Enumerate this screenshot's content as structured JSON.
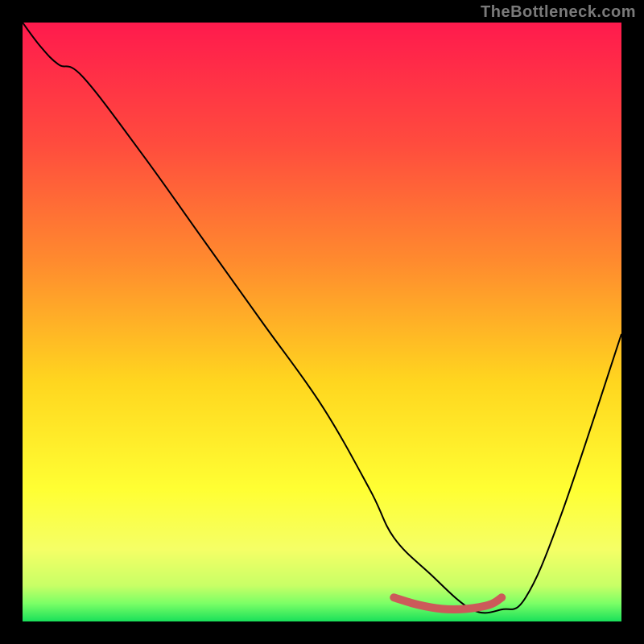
{
  "watermark": {
    "text": "TheBottleneck.com"
  },
  "chart_data": {
    "type": "line",
    "title": "",
    "xlabel": "",
    "ylabel": "",
    "xlim": [
      0,
      100
    ],
    "ylim": [
      0,
      100
    ],
    "gradient_stops": [
      {
        "pos": 0.0,
        "color": "#ff1a4d"
      },
      {
        "pos": 0.2,
        "color": "#ff4b3e"
      },
      {
        "pos": 0.4,
        "color": "#ff8b2e"
      },
      {
        "pos": 0.6,
        "color": "#ffd61f"
      },
      {
        "pos": 0.78,
        "color": "#ffff33"
      },
      {
        "pos": 0.88,
        "color": "#f5ff66"
      },
      {
        "pos": 0.94,
        "color": "#c8ff66"
      },
      {
        "pos": 0.97,
        "color": "#7bff66"
      },
      {
        "pos": 1.0,
        "color": "#19e05a"
      }
    ],
    "series": [
      {
        "name": "bottleneck-curve",
        "stroke": "#000000",
        "x": [
          0,
          3,
          6,
          10,
          20,
          30,
          40,
          50,
          58,
          62,
          68,
          75,
          80,
          84,
          90,
          100
        ],
        "y": [
          100,
          96,
          93,
          91,
          78,
          64,
          50,
          36,
          22,
          14,
          8,
          2,
          2,
          4,
          18,
          48
        ]
      }
    ],
    "highlight": {
      "name": "optimal-range",
      "stroke": "#cc5a5a",
      "width": 10,
      "x": [
        62,
        66,
        70,
        74,
        78,
        80
      ],
      "y": [
        4.0,
        2.8,
        2.1,
        2.1,
        2.8,
        4.0
      ]
    }
  }
}
